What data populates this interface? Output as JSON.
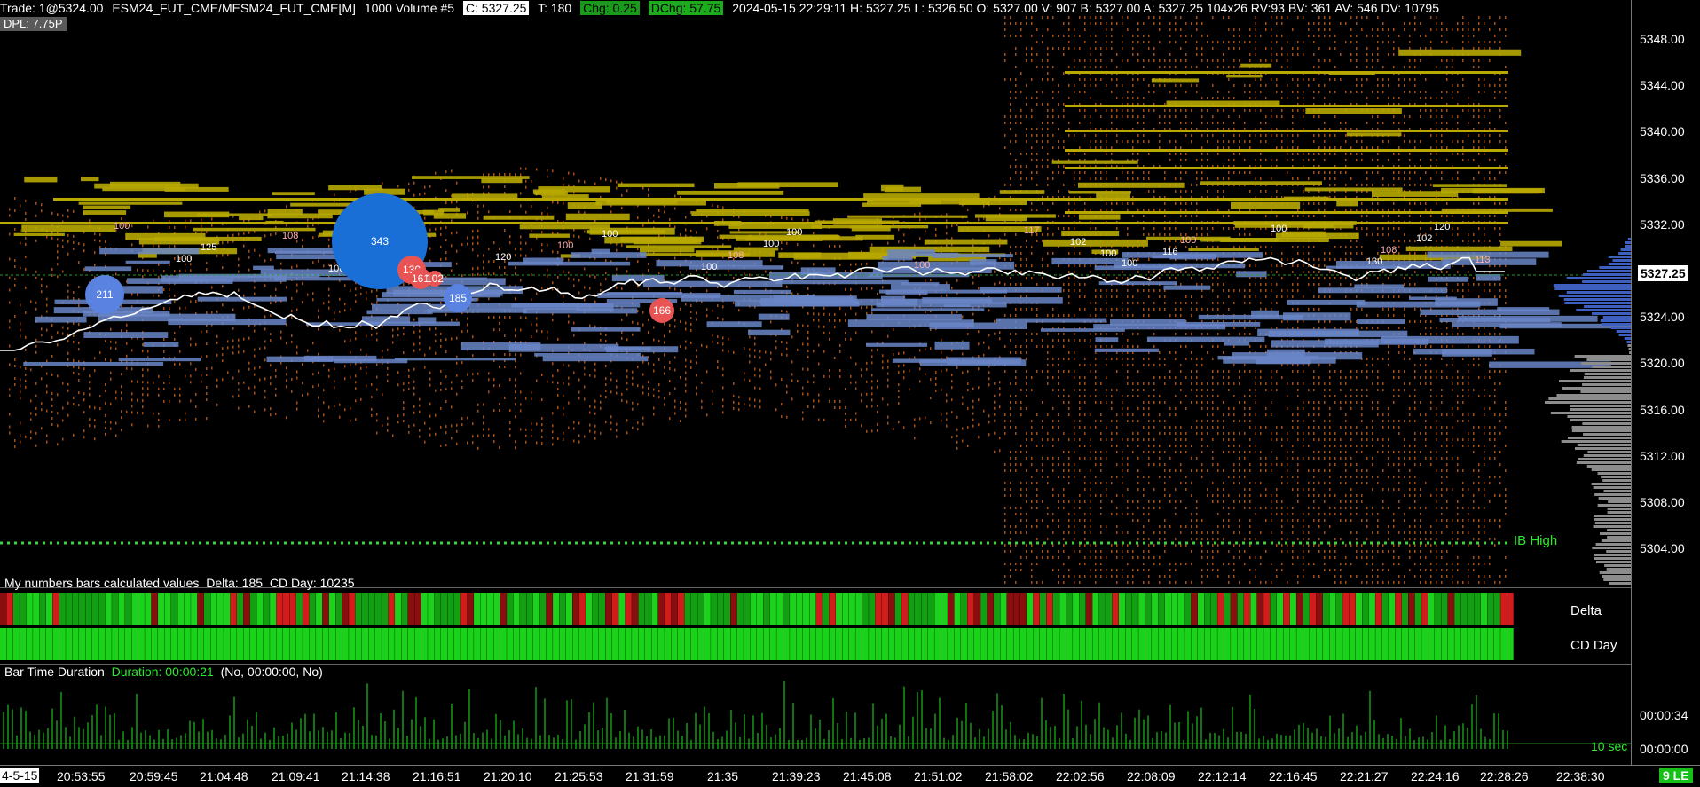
{
  "header": {
    "trade": "Trade: 1@5324.00",
    "symbol": "ESM24_FUT_CME/MESM24_FUT_CME[M]",
    "bar_type": "1000 Volume #5",
    "close": "C: 5327.25",
    "trades": "T: 180",
    "change": "Chg: 0.25",
    "day_change": "DChg: 57.75",
    "details": "2024-05-15 22:29:11 H: 5327.25 L: 5326.50 O: 5327.00 V: 907 B: 5327.00 A: 5327.25 104x26 RV:93 BV: 361 AV: 546 DV: 10795"
  },
  "dpl": "DPL: 7.75P",
  "price_axis": {
    "labels": [
      "5348.00",
      "5344.00",
      "5340.00",
      "5336.00",
      "5332.00",
      "5328.00",
      "5324.00",
      "5320.00",
      "5316.00",
      "5312.00",
      "5308.00",
      "5304.00"
    ],
    "current": "5327.25"
  },
  "ib_label": "IB High",
  "bubbles": [
    "343",
    "211",
    "185",
    "166",
    "130",
    "161",
    "102"
  ],
  "line_labels": [
    "100",
    "100",
    "125",
    "108",
    "100",
    "120",
    "100",
    "100",
    "100",
    "108",
    "100",
    "100",
    "100",
    "100",
    "102",
    "117",
    "100",
    "116",
    "100",
    "100",
    "130",
    "108",
    "102",
    "120",
    "113"
  ],
  "numbers_panel": {
    "title": "My numbers bars calculated values",
    "delta": "Delta: 185",
    "cd_day": "CD Day: 10235",
    "delta_label": "Delta",
    "cd_label": "CD Day"
  },
  "duration_panel": {
    "title": "Bar Time Duration",
    "duration": "Duration: 00:00:21",
    "extra": "(No, 00:00:00, No)",
    "axis_labels": [
      "00:00:34",
      "00:00:00"
    ],
    "sec_label": "10 sec"
  },
  "time_axis": {
    "first": "4-5-15",
    "labels": [
      "20:53:55",
      "20:59:45",
      "21:04:48",
      "21:09:41",
      "21:14:38",
      "21:16:51",
      "21:20:10",
      "21:25:53",
      "21:31:59",
      "21:35",
      "21:39:23",
      "21:45:08",
      "21:51:02",
      "21:58:02",
      "22:02:56",
      "22:08:09",
      "22:12:14",
      "22:16:45",
      "22:21:27",
      "22:24:16",
      "22:28:26",
      "22:38:30"
    ],
    "last": "9 LE"
  },
  "colors": {
    "up": "#ffffff",
    "gold": "#b8a800",
    "blue": "#6a86c8",
    "orange": "#c8641e",
    "green": "#18c018",
    "red": "#c81818",
    "bubble_blue": "#1a6fd6",
    "bubble_red": "#e85454"
  }
}
